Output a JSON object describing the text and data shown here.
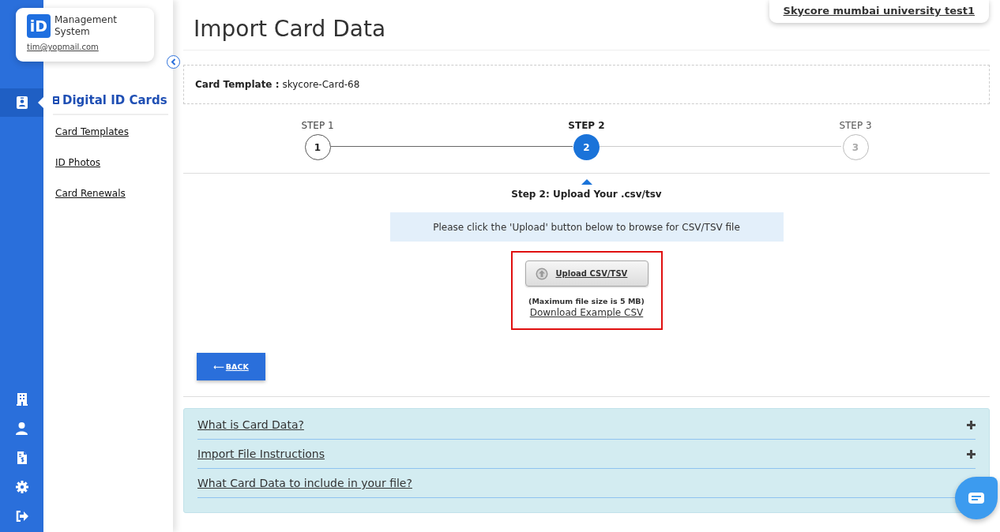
{
  "brand": {
    "logo": "iD",
    "name": "Management System",
    "email": "tim@yopmail.com"
  },
  "rail": [
    {
      "kind": "idcard",
      "selected": true
    },
    {
      "kind": "building",
      "selected": false
    },
    {
      "kind": "user",
      "selected": false
    },
    {
      "kind": "invoice",
      "selected": false
    },
    {
      "kind": "settings",
      "selected": false
    },
    {
      "kind": "logout",
      "selected": false
    }
  ],
  "sidebar": {
    "title": "Digital ID Cards",
    "items": [
      "Card Templates",
      "ID Photos",
      "Card Renewals"
    ]
  },
  "org": "Skycore mumbai university test1",
  "title": "Import Card Data",
  "template": {
    "label": "Card Template :",
    "value": "skycore-Card-68"
  },
  "steps": [
    {
      "label": "STEP 1",
      "number": "1",
      "completed": true,
      "selected": false
    },
    {
      "label": "STEP 2",
      "number": "2",
      "completed": false,
      "selected": true
    },
    {
      "label": "STEP 3",
      "number": "3",
      "completed": false,
      "selected": false
    }
  ],
  "step_heading": "Step 2: Upload Your .csv/tsv",
  "info": "Please click the 'Upload' button below to browse for CSV/TSV file",
  "upload": {
    "button": "Upload CSV/TSV",
    "note": "(Maximum file size is 5 MB)",
    "example_link": "Download Example CSV"
  },
  "back": {
    "arrow": "⟵",
    "label": "BACK"
  },
  "faq": [
    {
      "question": "What is Card Data?",
      "expanded": false
    },
    {
      "question": "Import File Instructions",
      "expanded": false
    },
    {
      "question": "What Card Data to include in your file?"
    }
  ]
}
